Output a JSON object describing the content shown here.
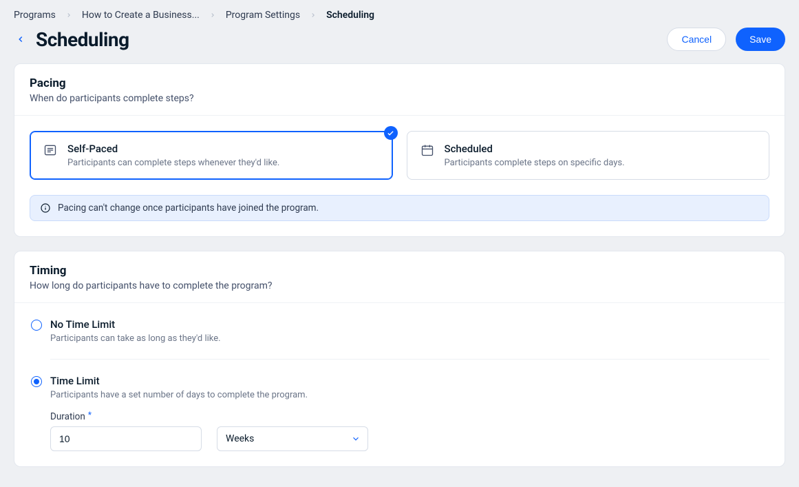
{
  "breadcrumb": {
    "items": [
      {
        "label": "Programs"
      },
      {
        "label": "How to Create a Business..."
      },
      {
        "label": "Program Settings"
      },
      {
        "label": "Scheduling",
        "current": true
      }
    ]
  },
  "header": {
    "title": "Scheduling",
    "cancel_label": "Cancel",
    "save_label": "Save"
  },
  "pacing": {
    "title": "Pacing",
    "subtitle": "When do participants complete steps?",
    "options": [
      {
        "title": "Self-Paced",
        "desc": "Participants can complete steps whenever they'd like.",
        "selected": true
      },
      {
        "title": "Scheduled",
        "desc": "Participants complete steps on specific days.",
        "selected": false
      }
    ],
    "info_text": "Pacing can't change once participants have joined the program."
  },
  "timing": {
    "title": "Timing",
    "subtitle": "How long do participants have to complete the program?",
    "options": [
      {
        "title": "No Time Limit",
        "desc": "Participants can take as long as they'd like.",
        "selected": false
      },
      {
        "title": "Time Limit",
        "desc": "Participants have a set number of days to complete the program.",
        "selected": true
      }
    ],
    "duration_label": "Duration",
    "duration_value": "10",
    "duration_unit": "Weeks"
  },
  "colors": {
    "accent": "#0F62FE",
    "bg": "#EEF0F3",
    "panel_bg": "#FFFFFF",
    "border": "#D6DCE6",
    "info_bg": "#E8F0FE",
    "text_muted": "#6B7588"
  }
}
